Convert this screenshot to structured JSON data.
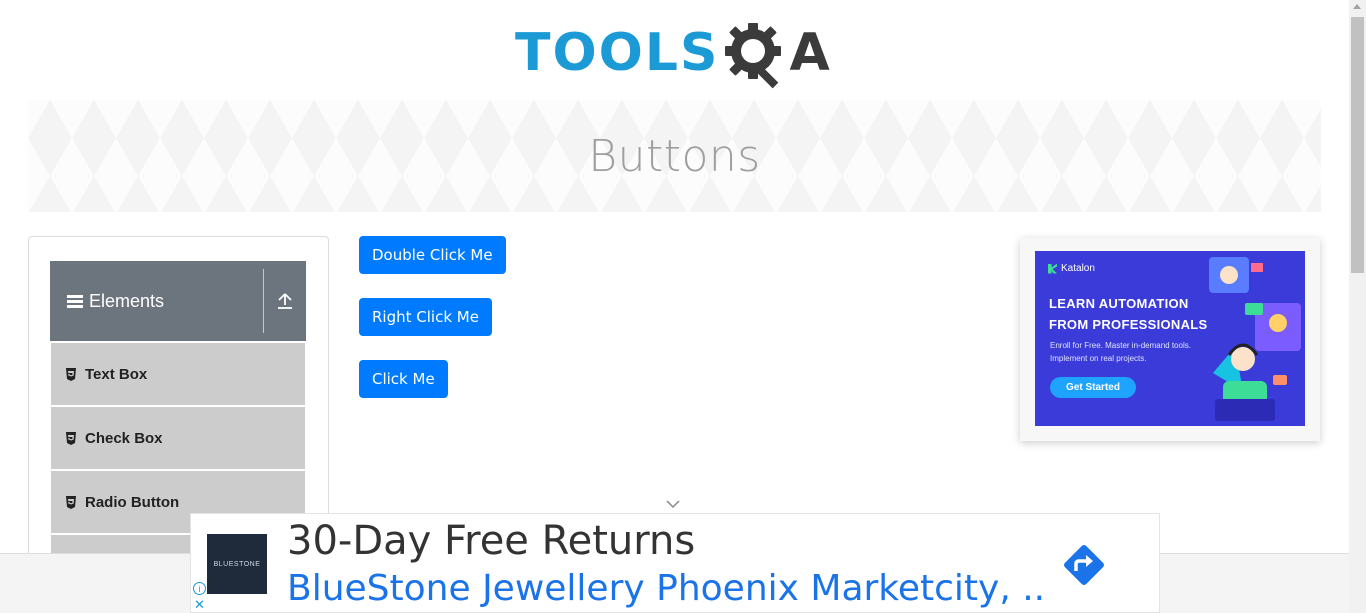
{
  "logo": {
    "text_left": "TOOLS",
    "text_right": "A",
    "alt": "ToolsQA"
  },
  "banner": {
    "title": "Buttons"
  },
  "sidebar": {
    "group_title": "Elements",
    "items": [
      {
        "label": "Text Box"
      },
      {
        "label": "Check Box"
      },
      {
        "label": "Radio Button"
      }
    ]
  },
  "buttons": {
    "double_click": "Double Click Me",
    "right_click": "Right Click Me",
    "click": "Click Me"
  },
  "side_ad": {
    "brand": "Katalon",
    "headline_line1": "LEARN AUTOMATION",
    "headline_line2": "FROM PROFESSIONALS",
    "subtext": "Enroll for Free. Master in-demand tools. Implement on real projects.",
    "cta": "Get Started"
  },
  "bottom_ad": {
    "thumb_text": "BLUESTONE",
    "headline": "30-Day Free Returns",
    "link": "BlueStone Jewellery Phoenix Marketcity, ...",
    "info_icon": "info-icon",
    "close_icon": "close-icon"
  },
  "colors": {
    "primary_button": "#007bff",
    "sidebar_header": "#6c757d",
    "sidebar_item": "#cccccc",
    "logo_blue": "#1b9ad6",
    "link_blue": "#1a73e8",
    "ad_background": "#3b3bd9"
  }
}
